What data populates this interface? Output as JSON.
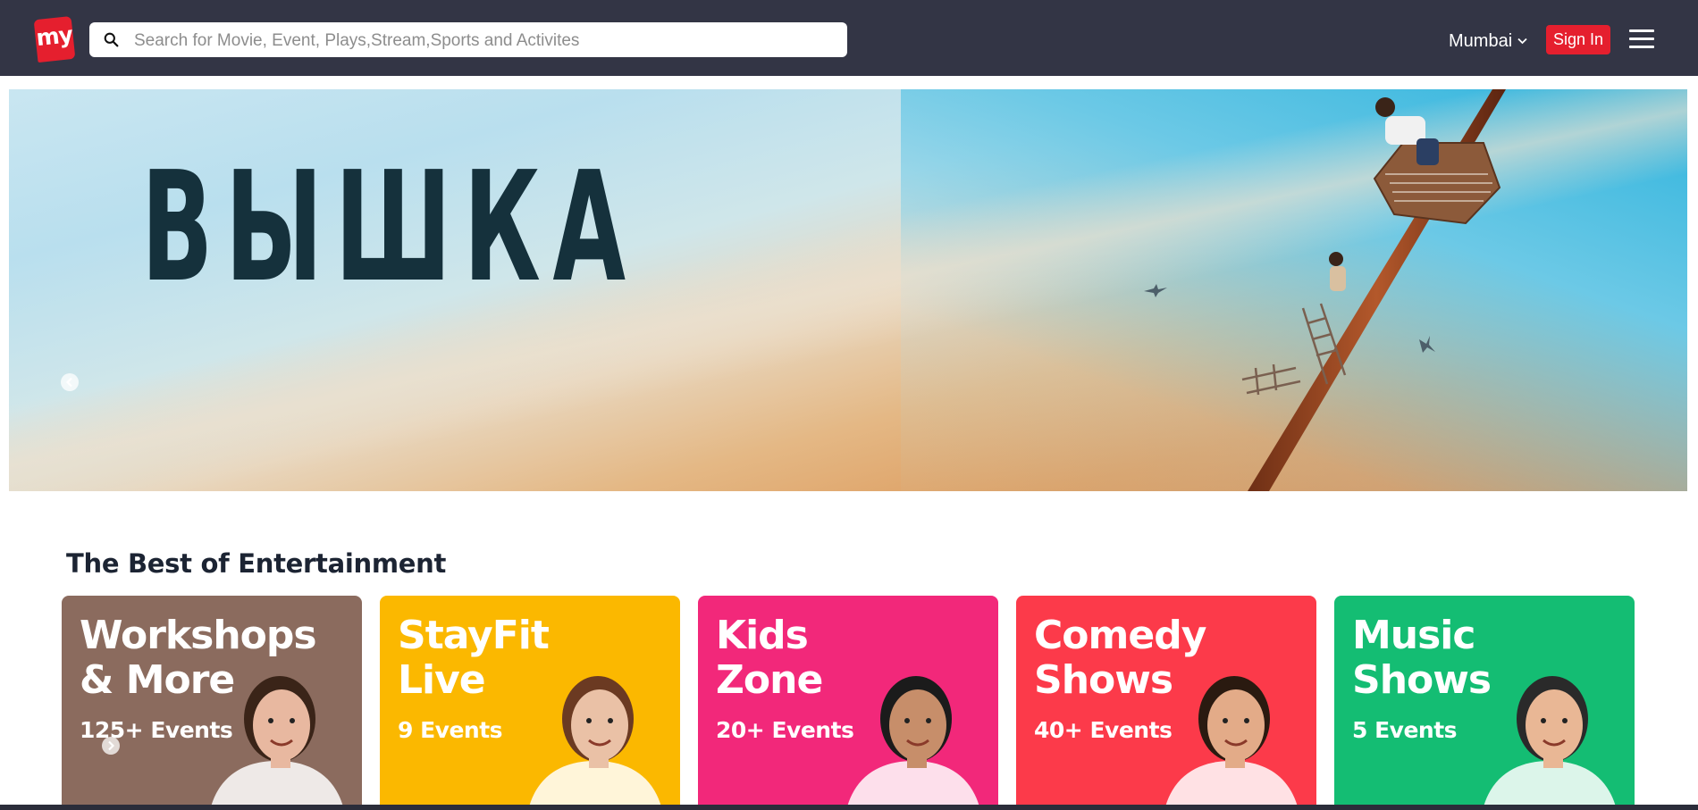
{
  "header": {
    "logo_text": "my",
    "search_placeholder": "Search for Movie, Event, Plays,Stream,Sports and Activites",
    "city": "Mumbai",
    "signin_label": "Sign In",
    "colors": {
      "navbar": "#333545",
      "accent": "#e51f2e"
    }
  },
  "hero": {
    "title": "ВЫШКА"
  },
  "section": {
    "title": "The Best of Entertainment"
  },
  "cards": [
    {
      "title": "Workshops\n& More",
      "count": "125+ Events",
      "color": "#8b6b5e"
    },
    {
      "title": "StayFit\nLive",
      "count": "9 Events",
      "color": "#fbb800"
    },
    {
      "title": "Kids\nZone",
      "count": "20+ Events",
      "color": "#f2287a"
    },
    {
      "title": "Comedy\nShows",
      "count": "40+ Events",
      "color": "#fc3a4a"
    },
    {
      "title": "Music\nShows",
      "count": "5 Events",
      "color": "#14bd73"
    }
  ]
}
